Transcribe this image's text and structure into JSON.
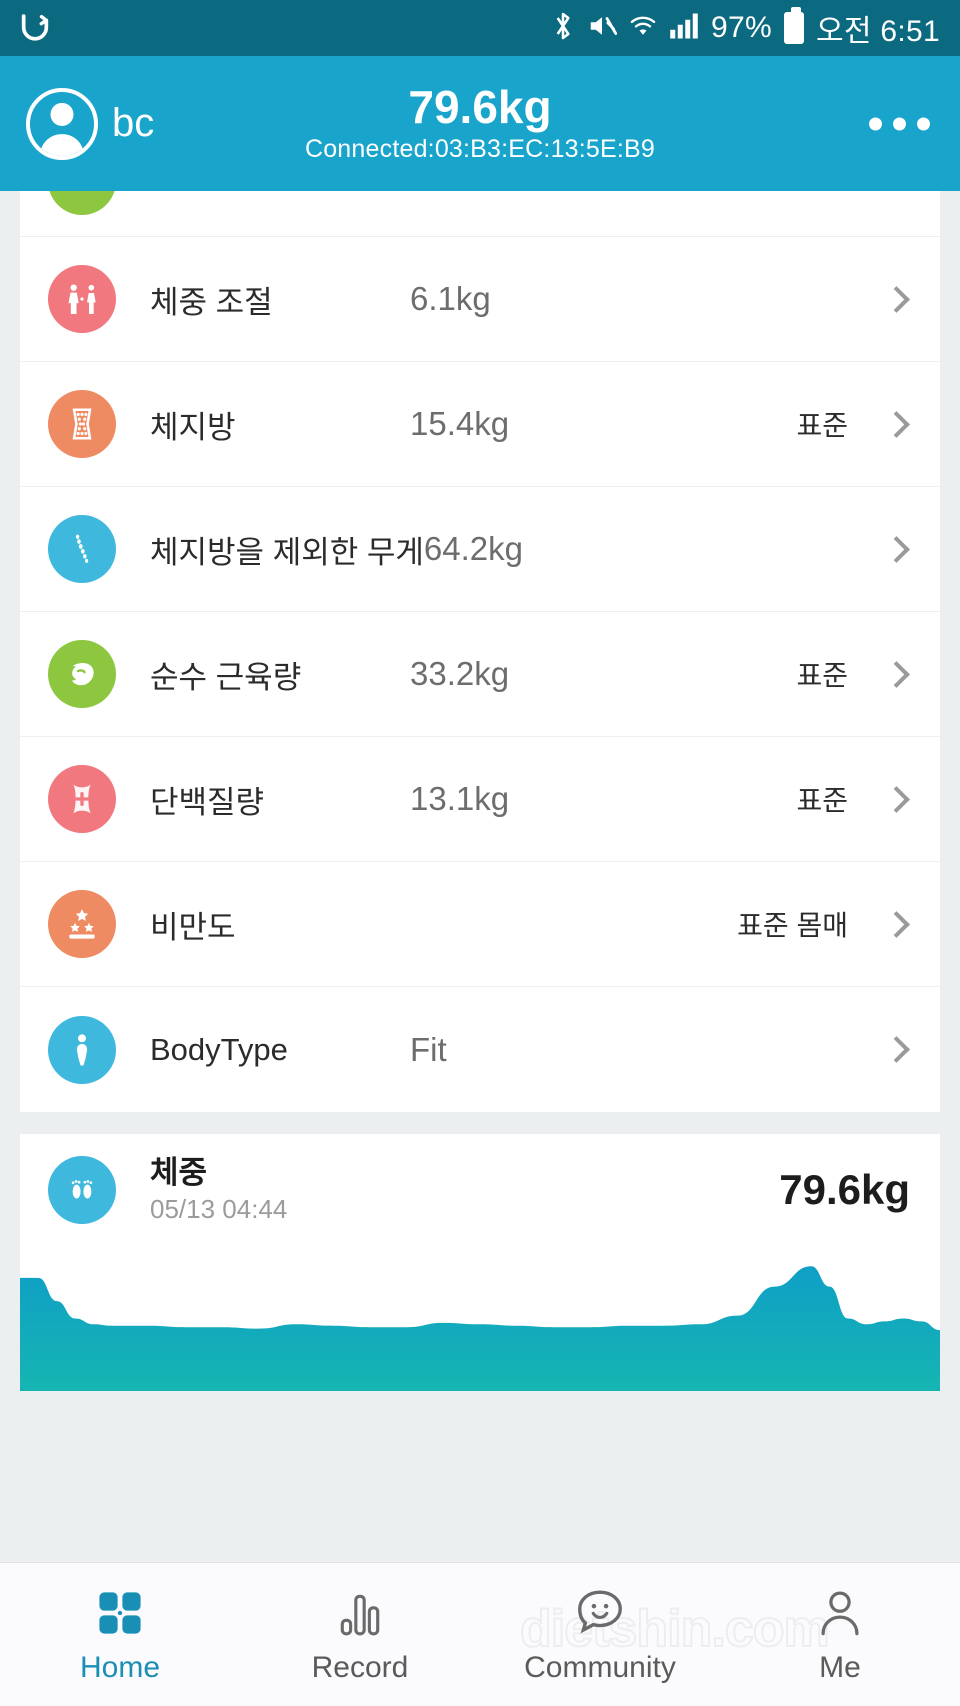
{
  "statusbar": {
    "carrier_icon": "carrier-logo-icon",
    "icons": [
      "bluetooth-icon",
      "mute-icon",
      "wifi-icon",
      "signal-icon"
    ],
    "battery_percent": "97%",
    "time": "오전 6:51"
  },
  "header": {
    "avatar_icon": "user-avatar-icon",
    "username": "bc",
    "weight": "79.6kg",
    "connection": "Connected:03:B3:EC:13:5E:B9",
    "menu_icon": "more-options-icon"
  },
  "metrics": [
    {
      "icon": "weight-control-icon",
      "icon_color": "#f0787e",
      "label": "체중 조절",
      "value": "6.1kg",
      "status": "",
      "chevron": "chevron-right-icon"
    },
    {
      "icon": "body-fat-icon",
      "icon_color": "#ef8b63",
      "label": "체지방",
      "value": "15.4kg",
      "status": "표준",
      "chevron": "chevron-right-icon"
    },
    {
      "icon": "fat-free-mass-icon",
      "icon_color": "#3fb8dd",
      "label": "체지방을 제외한 무게",
      "value": "64.2kg",
      "status": "",
      "chevron": "chevron-right-icon"
    },
    {
      "icon": "muscle-icon",
      "icon_color": "#8dc63f",
      "label": "순수 근육량",
      "value": "33.2kg",
      "status": "표준",
      "chevron": "chevron-right-icon"
    },
    {
      "icon": "protein-icon",
      "icon_color": "#f0787e",
      "label": "단백질량",
      "value": "13.1kg",
      "status": "표준",
      "chevron": "chevron-right-icon"
    },
    {
      "icon": "obesity-icon",
      "icon_color": "#ef8b63",
      "label": "비만도",
      "value": "",
      "status": "표준 몸매",
      "chevron": "chevron-right-icon"
    },
    {
      "icon": "body-type-icon",
      "icon_color": "#3fb8dd",
      "label": "BodyType",
      "value": "Fit",
      "status": "",
      "chevron": "chevron-right-icon"
    }
  ],
  "weight_card": {
    "icon": "footprints-icon",
    "icon_color": "#3fb8dd",
    "title": "체중",
    "timestamp": "05/13 04:44",
    "value": "79.6kg"
  },
  "chart_data": {
    "type": "area",
    "title": "체중",
    "xlabel": "",
    "ylabel": "",
    "grid": false,
    "legend": "none",
    "fill_top_color": "#0f9fc6",
    "fill_bottom_color": "#16b5b2",
    "x": [
      0,
      2,
      4,
      6,
      8,
      10,
      14,
      18,
      22,
      26,
      30,
      34,
      38,
      42,
      46,
      50,
      54,
      58,
      62,
      66,
      70,
      74,
      78,
      82,
      86,
      88,
      90,
      92,
      94,
      96,
      98,
      100
    ],
    "values": [
      78,
      78,
      62,
      50,
      46,
      45,
      45,
      44,
      44,
      43,
      46,
      45,
      44,
      44,
      47,
      46,
      45,
      44,
      44,
      45,
      45,
      46,
      52,
      72,
      86,
      72,
      50,
      46,
      48,
      50,
      48,
      42
    ]
  },
  "nav": {
    "watermark": "dietshin.com",
    "items": [
      {
        "label": "Home",
        "icon": "grid-home-icon",
        "active": true
      },
      {
        "label": "Record",
        "icon": "bar-chart-icon",
        "active": false
      },
      {
        "label": "Community",
        "icon": "chat-smiley-icon",
        "active": false
      },
      {
        "label": "Me",
        "icon": "person-icon",
        "active": false
      }
    ]
  },
  "colors": {
    "status_bar": "#0b6a80",
    "header": "#18a4cb",
    "page_bg": "#eceff0",
    "accent": "#1a8fb5"
  }
}
